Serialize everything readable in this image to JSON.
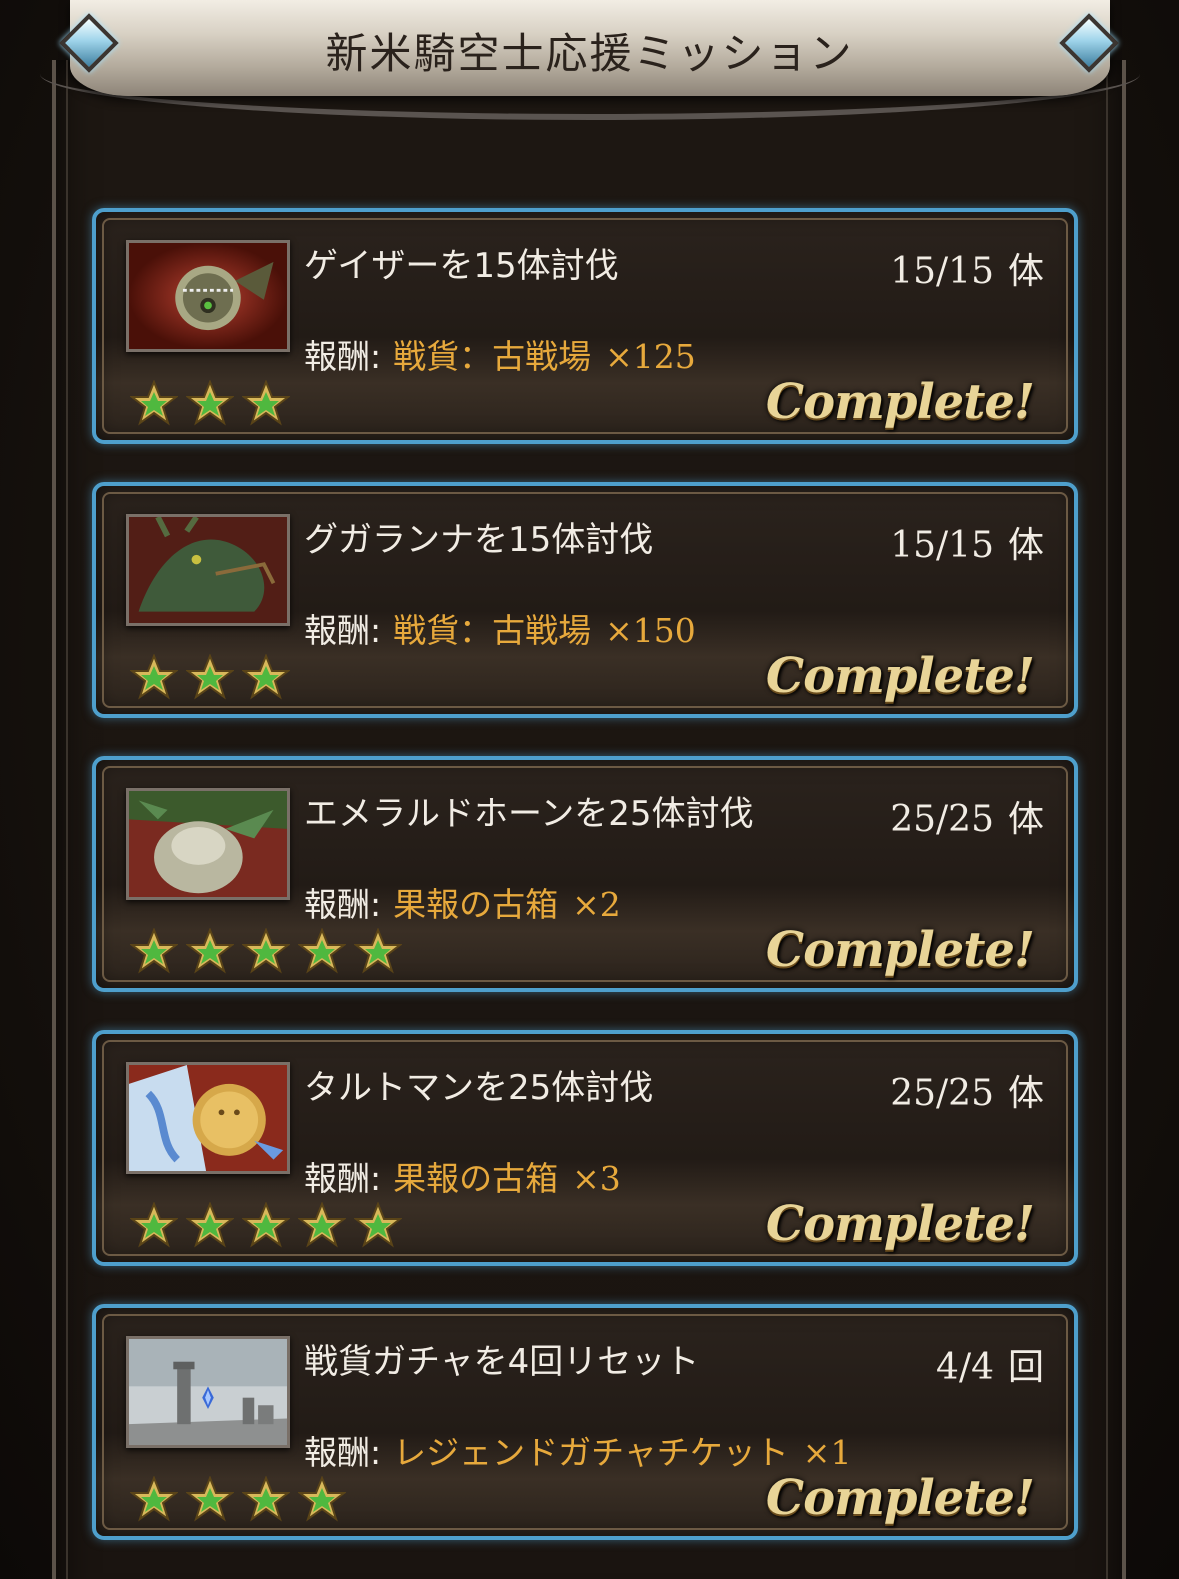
{
  "title": "新米騎空士応援ミッション",
  "missions": [
    {
      "name": "ゲイザーを15体討伐",
      "progress": "15/15",
      "unit": "体",
      "reward_label": "報酬:",
      "reward_item": "戦貨：古戦場",
      "reward_qty": "×125",
      "stars": 3,
      "status": "Complete!",
      "thumb_icon": "gazer-monster-icon"
    },
    {
      "name": "グガランナを15体討伐",
      "progress": "15/15",
      "unit": "体",
      "reward_label": "報酬:",
      "reward_item": "戦貨：古戦場",
      "reward_qty": "×150",
      "stars": 3,
      "status": "Complete!",
      "thumb_icon": "gugalanna-monster-icon"
    },
    {
      "name": "エメラルドホーンを25体討伐",
      "progress": "25/25",
      "unit": "体",
      "reward_label": "報酬:",
      "reward_item": "果報の古箱",
      "reward_qty": "×2",
      "stars": 5,
      "status": "Complete!",
      "thumb_icon": "emerald-horn-monster-icon"
    },
    {
      "name": "タルトマンを25体討伐",
      "progress": "25/25",
      "unit": "体",
      "reward_label": "報酬:",
      "reward_item": "果報の古箱",
      "reward_qty": "×3",
      "stars": 5,
      "status": "Complete!",
      "thumb_icon": "tartman-monster-icon"
    },
    {
      "name": "戦貨ガチャを4回リセット",
      "progress": "4/4",
      "unit": "回",
      "reward_label": "報酬:",
      "reward_item": "レジェンドガチャチケット",
      "reward_qty": "×1",
      "stars": 4,
      "status": "Complete!",
      "thumb_icon": "ruins-landscape-icon"
    }
  ],
  "colors": {
    "card_border": "#4e9fcc",
    "reward_text": "#e7a93c",
    "complete_text": "#e8d497",
    "star_fill": "#4fb83f"
  }
}
